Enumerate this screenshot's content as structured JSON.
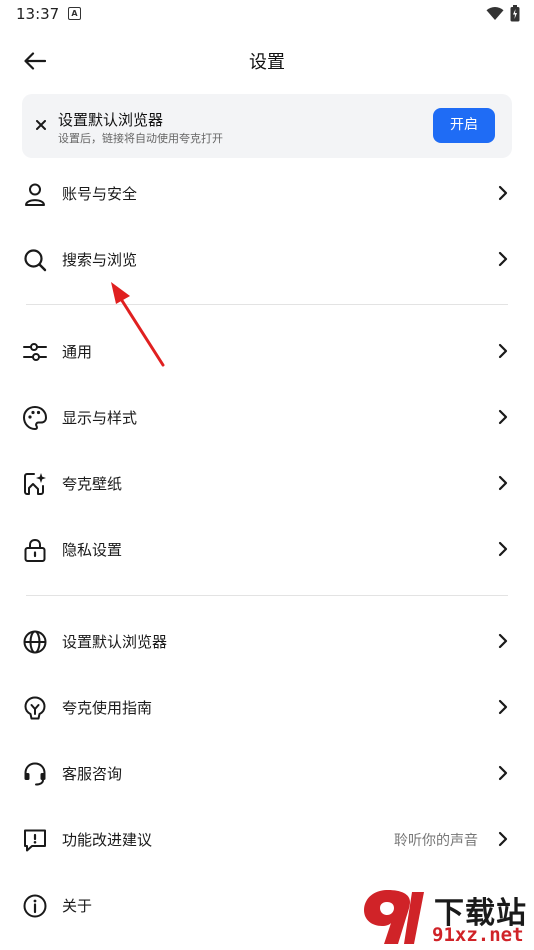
{
  "status_bar": {
    "time": "13:37",
    "notification_letter": "A"
  },
  "header": {
    "title": "设置"
  },
  "banner": {
    "title": "设置默认浏览器",
    "subtitle": "设置后，链接将自动使用夸克打开",
    "button_label": "开启"
  },
  "section1": [
    {
      "label": "账号与安全",
      "icon": "person-icon"
    },
    {
      "label": "搜索与浏览",
      "icon": "search-icon"
    }
  ],
  "section2": [
    {
      "label": "通用",
      "icon": "sliders-icon"
    },
    {
      "label": "显示与样式",
      "icon": "palette-icon"
    },
    {
      "label": "夸克壁纸",
      "icon": "wallpaper-icon"
    },
    {
      "label": "隐私设置",
      "icon": "lock-icon"
    }
  ],
  "section3": [
    {
      "label": "设置默认浏览器",
      "icon": "globe-icon"
    },
    {
      "label": "夸克使用指南",
      "icon": "bulb-icon"
    },
    {
      "label": "客服咨询",
      "icon": "headset-icon"
    },
    {
      "label": "功能改进建议",
      "value": "聆听你的声音",
      "icon": "feedback-icon"
    },
    {
      "label": "关于",
      "icon": "info-icon"
    }
  ],
  "watermark": {
    "line1": "下载站",
    "line2": "91xz.net"
  },
  "colors": {
    "accent": "#1f6cf5",
    "annotation_arrow": "#e02020",
    "watermark_red": "#d02328"
  }
}
